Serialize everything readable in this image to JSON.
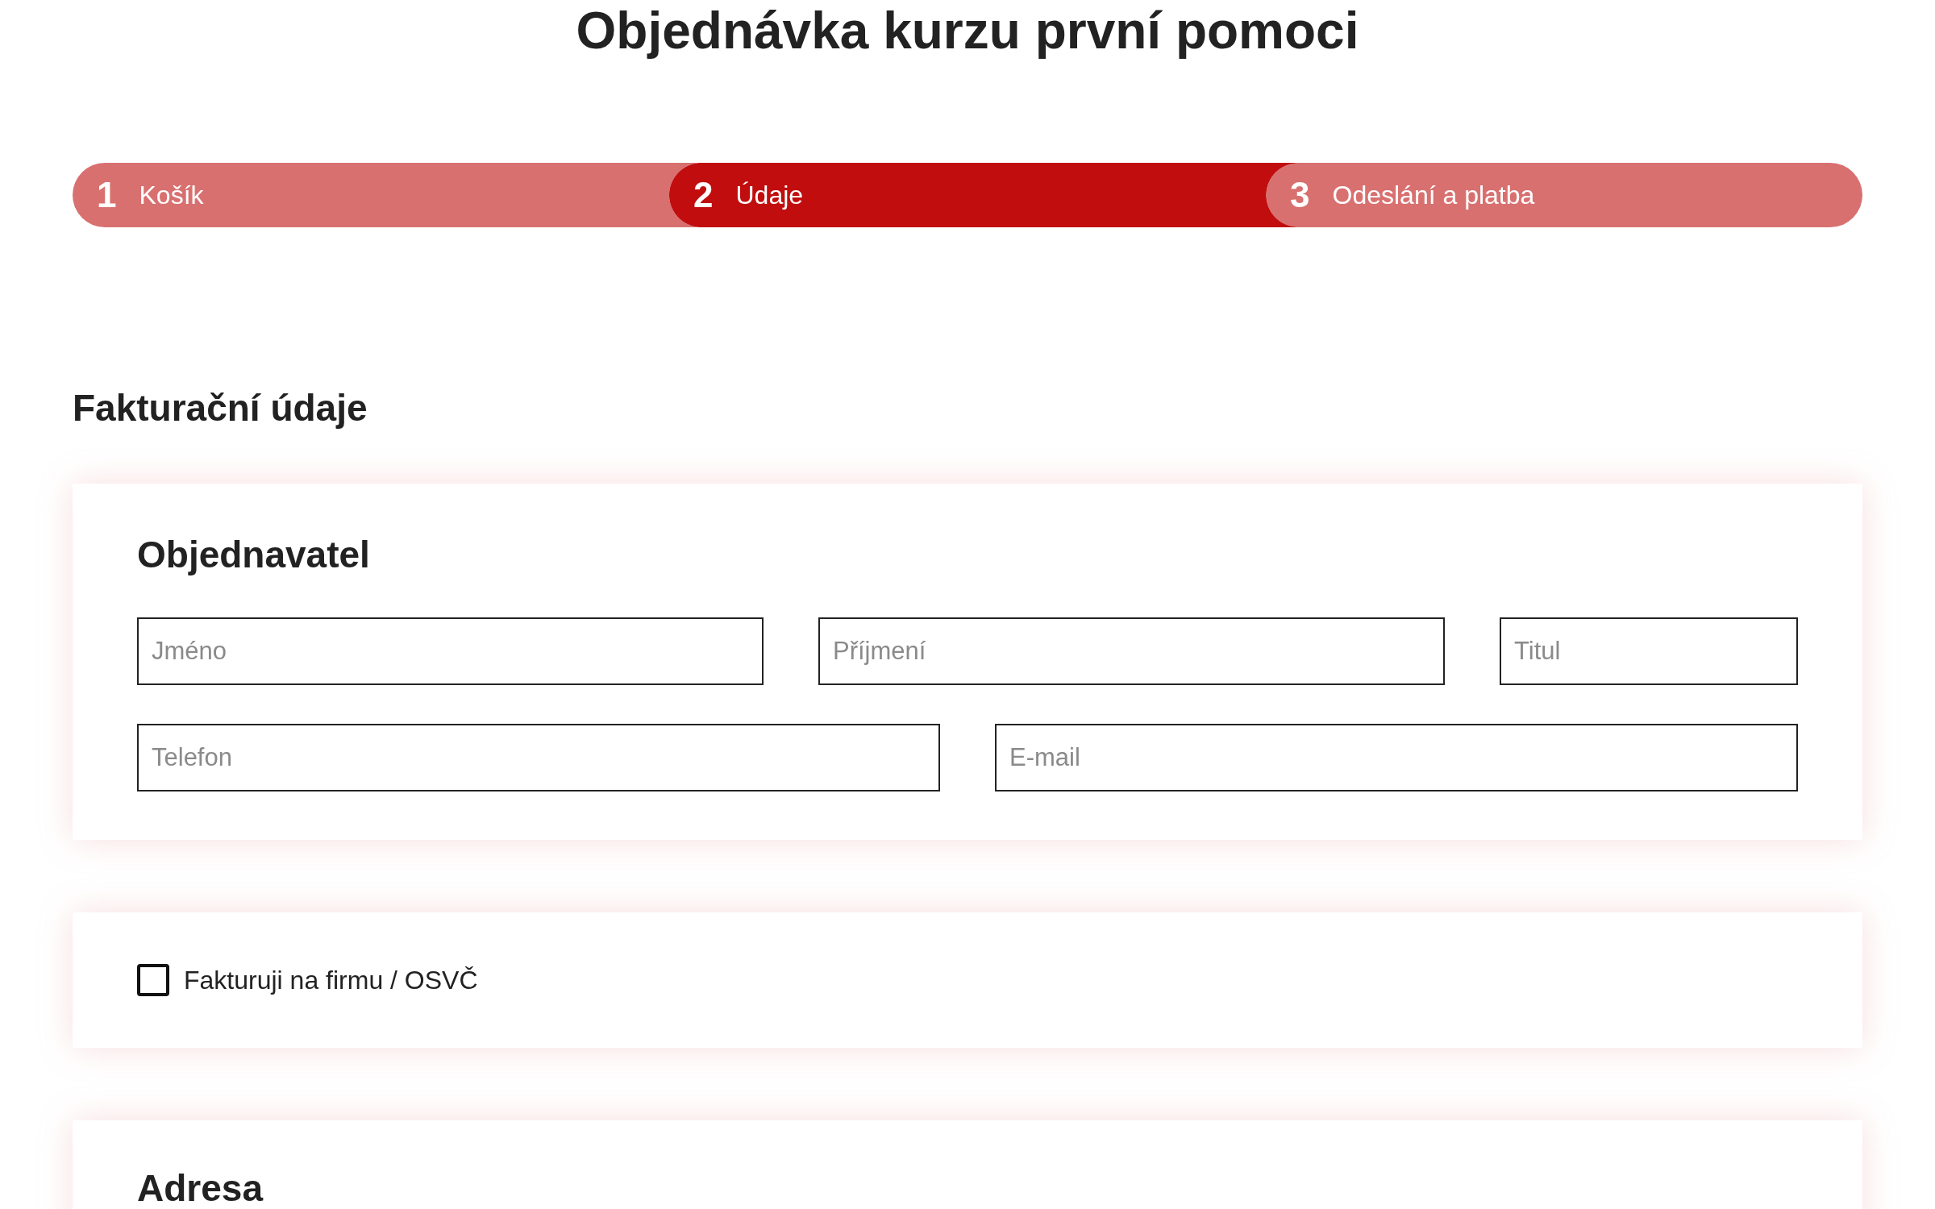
{
  "page_title": "Objednávka kurzu první pomoci",
  "steps": [
    {
      "number": "1",
      "label": "Košík",
      "selected": false
    },
    {
      "number": "2",
      "label": "Údaje",
      "selected": true
    },
    {
      "number": "3",
      "label": "Odeslání a platba",
      "selected": false
    }
  ],
  "section_title": "Fakturační údaje",
  "orderer": {
    "title": "Objednavatel",
    "rows": [
      [
        {
          "placeholder": "Jméno"
        },
        {
          "placeholder": "Příjmení"
        },
        {
          "placeholder": "Titul"
        }
      ],
      [
        {
          "placeholder": "Telefon"
        },
        {
          "placeholder": "E-mail"
        }
      ]
    ]
  },
  "company_checkbox": {
    "label": "Fakturuji na firmu / OSVČ",
    "checked": false
  },
  "address": {
    "title": "Adresa"
  }
}
